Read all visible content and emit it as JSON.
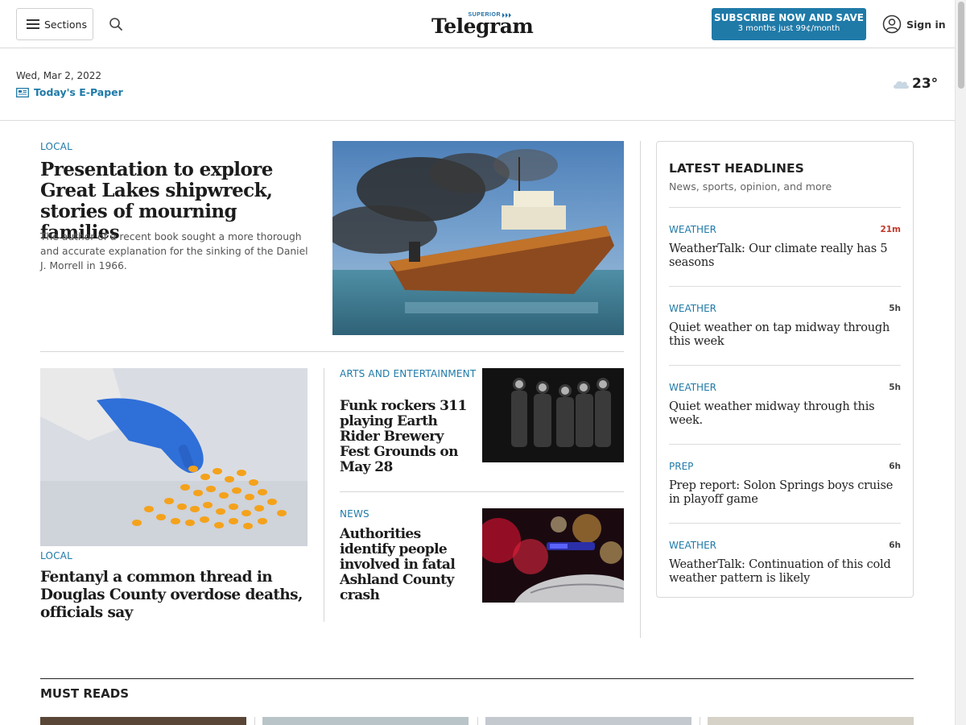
{
  "header": {
    "sections_label": "Sections",
    "logo_small": "SUPERIOR",
    "logo_main": "Telegram",
    "subscribe_line1": "SUBSCRIBE NOW AND SAVE",
    "subscribe_line2": "3 months just 99¢/month",
    "signin_label": "Sign in",
    "accent": "#1f7aa8"
  },
  "datebar": {
    "date": "Wed, Mar 2, 2022",
    "epaper": "Today's E-Paper",
    "temperature": "23°"
  },
  "lead": {
    "kicker": "LOCAL",
    "title": "Presentation to explore Great Lakes shipwreck, stories of mourning families",
    "summary": "The author of a recent book sought a more thorough and accurate explanation for the sinking of the Daniel J. Morrell in 1966."
  },
  "fentanyl": {
    "kicker": "LOCAL",
    "title": "Fentanyl a common thread in Douglas County overdose deaths, officials say"
  },
  "stories": [
    {
      "kicker": "ARTS AND ENTERTAINMENT",
      "title": "Funk rockers 311 playing Earth Rider Brewery Fest Grounds on May 28"
    },
    {
      "kicker": "NEWS",
      "title": "Authorities identify people involved in fatal Ashland County crash"
    }
  ],
  "latest": {
    "title": "LATEST HEADLINES",
    "subtitle": "News, sports, opinion, and more",
    "items": [
      {
        "category": "WEATHER",
        "time": "21m",
        "title": "WeatherTalk: Our climate really has 5 seasons"
      },
      {
        "category": "WEATHER",
        "time": "5h",
        "title": "Quiet weather on tap midway through this week"
      },
      {
        "category": "WEATHER",
        "time": "5h",
        "title": "Quiet weather midway through this week."
      },
      {
        "category": "PREP",
        "time": "6h",
        "title": "Prep report: Solon Springs boys cruise in playoff game"
      },
      {
        "category": "WEATHER",
        "time": "6h",
        "title": "WeatherTalk: Continuation of this cold weather pattern is likely"
      }
    ]
  },
  "must_reads": {
    "title": "MUST READS"
  }
}
